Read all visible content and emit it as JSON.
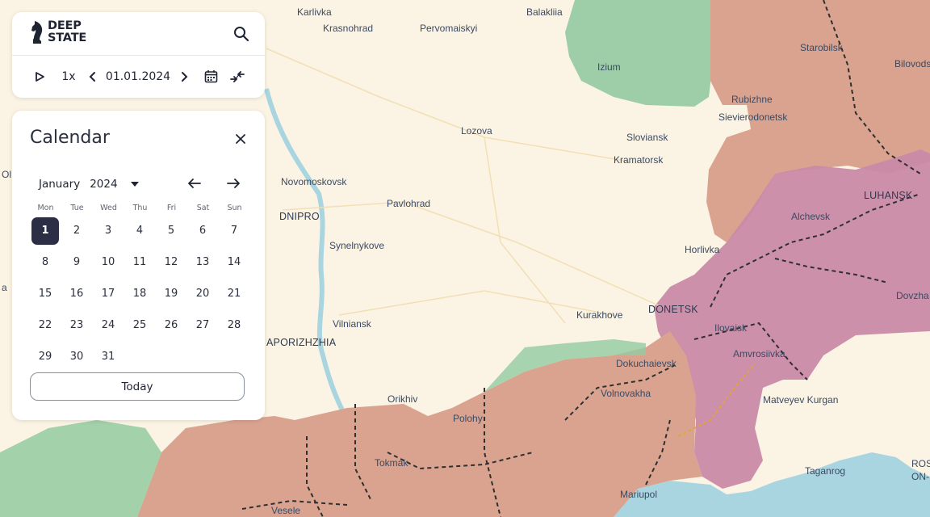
{
  "app": {
    "logo_line1": "DEEP",
    "logo_line2": "STATE"
  },
  "toolbar": {
    "speed": "1x",
    "date": "01.01.2024"
  },
  "calendar": {
    "title": "Calendar",
    "month": "January",
    "year": "2024",
    "weekdays": [
      "Mon",
      "Tue",
      "Wed",
      "Thu",
      "Fri",
      "Sat",
      "Sun"
    ],
    "days": [
      "1",
      "2",
      "3",
      "4",
      "5",
      "6",
      "7",
      "8",
      "9",
      "10",
      "11",
      "12",
      "13",
      "14",
      "15",
      "16",
      "17",
      "18",
      "19",
      "20",
      "21",
      "22",
      "23",
      "24",
      "25",
      "26",
      "27",
      "28",
      "29",
      "30",
      "31"
    ],
    "selected_day": "1",
    "today_label": "Today"
  },
  "map": {
    "labels": [
      {
        "name": "Karlivka"
      },
      {
        "name": "Krasnohrad"
      },
      {
        "name": "Pervomaiskyi"
      },
      {
        "name": "Balakliia"
      },
      {
        "name": "Izium"
      },
      {
        "name": "Starobilsk"
      },
      {
        "name": "Bilovods"
      },
      {
        "name": "Rubizhne"
      },
      {
        "name": "Sievierodonetsk"
      },
      {
        "name": "Lozova"
      },
      {
        "name": "Sloviansk"
      },
      {
        "name": "Kramatorsk"
      },
      {
        "name": "Novomoskovsk"
      },
      {
        "name": "Pavlohrad"
      },
      {
        "name": "DNIPRO"
      },
      {
        "name": "LUHANSK"
      },
      {
        "name": "Alchevsk"
      },
      {
        "name": "Synelnykove"
      },
      {
        "name": "Horlivka"
      },
      {
        "name": "DONETSK"
      },
      {
        "name": "Kurakhove"
      },
      {
        "name": "Ilovaisk"
      },
      {
        "name": "Amvrosiivka"
      },
      {
        "name": "Dovzha"
      },
      {
        "name": "Vilniansk"
      },
      {
        "name": "APORIZHZHIA"
      },
      {
        "name": "Dokuchaievsk"
      },
      {
        "name": "Volnovakha"
      },
      {
        "name": "Matveyev Kurgan"
      },
      {
        "name": "Orikhiv"
      },
      {
        "name": "Polohy"
      },
      {
        "name": "Tokmak"
      },
      {
        "name": "Taganrog"
      },
      {
        "name": "ROS"
      },
      {
        "name": "ON-"
      },
      {
        "name": "Mariupol"
      },
      {
        "name": "Vesele"
      },
      {
        "name": "Ol"
      },
      {
        "name": "a"
      }
    ],
    "colors": {
      "land": "#fbf3e3",
      "occupied": "#d9a38f",
      "liberated": "#92caa0",
      "occupied_before": "#c98aa8",
      "water": "#a9d5e0"
    }
  }
}
